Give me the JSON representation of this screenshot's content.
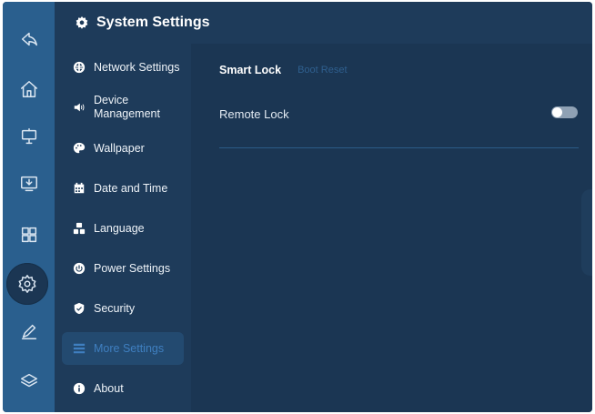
{
  "header": {
    "title": "System Settings",
    "icon": "gear-icon"
  },
  "dock": {
    "items": [
      {
        "name": "back",
        "icon": "back-icon"
      },
      {
        "name": "home",
        "icon": "home-icon"
      },
      {
        "name": "whiteboard",
        "icon": "whiteboard-icon"
      },
      {
        "name": "screen-share",
        "icon": "screen-share-icon"
      },
      {
        "name": "apps",
        "icon": "apps-grid-icon"
      },
      {
        "name": "settings",
        "icon": "settings-icon",
        "active": true
      },
      {
        "name": "annotate",
        "icon": "pen-icon"
      },
      {
        "name": "layers",
        "icon": "layers-icon"
      }
    ]
  },
  "menu": {
    "items": [
      {
        "label": "Network Settings",
        "icon": "globe-icon"
      },
      {
        "label": "Device Management",
        "icon": "speaker-icon"
      },
      {
        "label": "Wallpaper",
        "icon": "palette-icon"
      },
      {
        "label": "Date and Time",
        "icon": "calendar-icon"
      },
      {
        "label": "Language",
        "icon": "language-icon"
      },
      {
        "label": "Power Settings",
        "icon": "power-icon"
      },
      {
        "label": "Security",
        "icon": "shield-icon"
      },
      {
        "label": "More Settings",
        "icon": "list-icon",
        "active": true
      },
      {
        "label": "About",
        "icon": "info-icon"
      }
    ]
  },
  "content": {
    "tabs": [
      {
        "label": "Smart Lock",
        "active": true
      },
      {
        "label": "Boot Reset",
        "active": false
      }
    ],
    "remote_lock": {
      "label": "Remote Lock",
      "enabled": false
    }
  },
  "colors": {
    "background": "#1b3653",
    "dock": "#2a5f8e",
    "accent": "#3f7fc0",
    "active_item_bg": "#234a70"
  }
}
